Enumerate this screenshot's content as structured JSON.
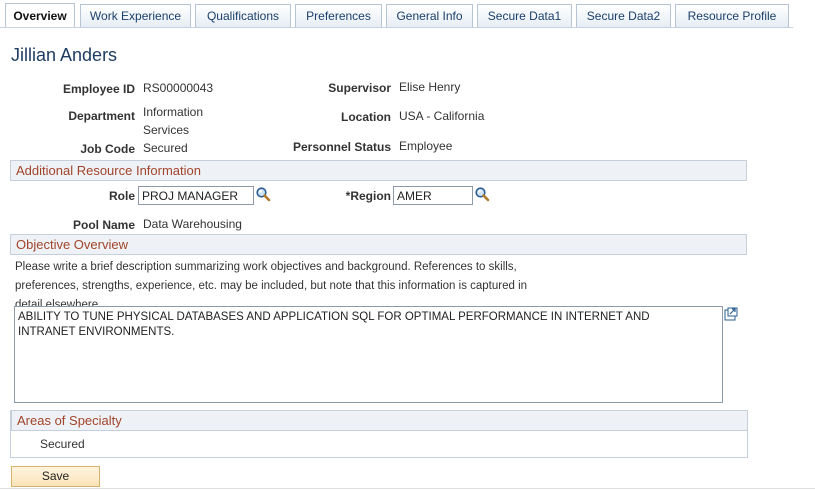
{
  "tabs": [
    {
      "label": "Overview",
      "active": true
    },
    {
      "label": "Work Experience",
      "active": false
    },
    {
      "label": "Qualifications",
      "active": false
    },
    {
      "label": "Preferences",
      "active": false
    },
    {
      "label": "General Info",
      "active": false
    },
    {
      "label": "Secure Data1",
      "active": false
    },
    {
      "label": "Secure Data2",
      "active": false
    },
    {
      "label": "Resource Profile",
      "active": false
    }
  ],
  "header": {
    "name": "Jillian Anders"
  },
  "summary": {
    "employee_id_label": "Employee ID",
    "employee_id": "RS00000043",
    "supervisor_label": "Supervisor",
    "supervisor": "Elise Henry",
    "department_label": "Department",
    "department_line1": "Information",
    "department_line2": "Services",
    "location_label": "Location",
    "location": "USA - California",
    "job_code_label": "Job Code",
    "job_code": "Secured",
    "personnel_status_label": "Personnel Status",
    "personnel_status": "Employee"
  },
  "additional": {
    "section_title": "Additional Resource Information",
    "role_label": "Role",
    "role_value": "PROJ MANAGER",
    "region_label": "*Region",
    "region_value": "AMER",
    "pool_name_label": "Pool Name",
    "pool_name": "Data Warehousing"
  },
  "objective": {
    "section_title": "Objective Overview",
    "description_line1": "Please write a brief description summarizing work objectives and background. References to skills,",
    "description_line2": "preferences, strengths, experience, etc. may be included, but note that this information is captured in",
    "description_line3": "detail elsewhere.",
    "text": "ABILITY TO TUNE PHYSICAL DATABASES AND APPLICATION SQL FOR OPTIMAL PERFORMANCE IN INTERNET AND\nINTRANET ENVIRONMENTS."
  },
  "areas": {
    "section_title": "Areas of Specialty",
    "value": "Secured"
  },
  "actions": {
    "save_label": "Save"
  },
  "icons": {
    "lookup": "magnifier-icon",
    "expand": "expand-textarea-icon"
  }
}
